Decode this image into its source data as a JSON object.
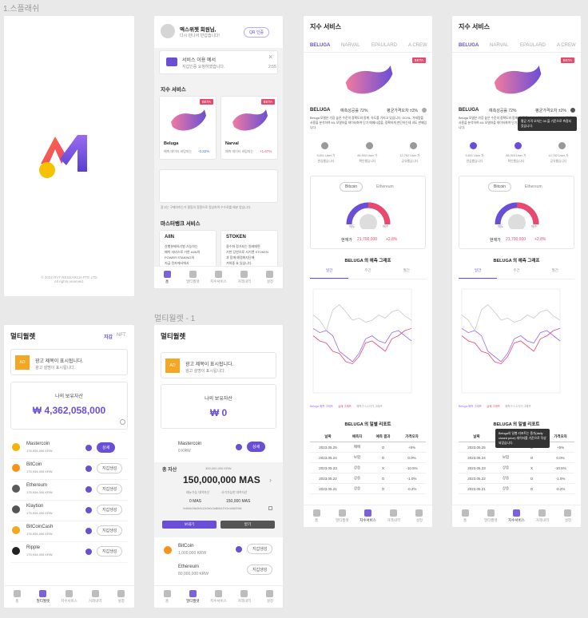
{
  "captions": {
    "splash": "1.스플래쉬",
    "wallet1": "멀티월렛 - 1"
  },
  "splash": {
    "copyright": "© 2022 RVT RESEARCH PTE LTD\nAll rights reserved."
  },
  "home": {
    "greeting": "엑스위젯 회원님,",
    "greeting_sub": "다시 만나서 반갑습니다!",
    "qr_button": "QR 인증",
    "notice_title": "서비스 이용 예서",
    "notice_body": "지갑인증 요청하였습니다.",
    "notice_time": "2:55",
    "index_section": "지수 서비스",
    "beta": "BETA",
    "beluga_name": "Beluga",
    "beluga_sub": "예측 데이터 바탕파는",
    "beluga_change": "-0.32%",
    "narval_name": "Narval",
    "narval_sub": "예측 데이터 바탕파는",
    "narval_change": "+1.67%",
    "banner_caption": "광고는 구매하하는가 필링의 정환으로 정상하여 수수료를 배분 받습니다.",
    "mastercard_section": "마스터뱅크 서비스",
    "ain_title": "AIIN",
    "ain_body": "산행분배하기벌 기능하는\n매칙 서비스로 거한 AIIN의\nPOWER STAKING의\n지급 전자에서에서",
    "token_title": "STOKEN",
    "token_body": "용수화 정거되는 원레매면\n기반 당연으로 서기엔 STOKEN\n과 함께 예정화지단에\n겨워중 효 있습니다."
  },
  "tabs": [
    "홈",
    "멀티월렛",
    "지수서비스",
    "거래내역",
    "설정"
  ],
  "wallet_a": {
    "title": "멀티월렛",
    "tab_wallet": "지갑",
    "tab_nft": "NFT",
    "ad_logo": "AD",
    "ad_title": "광고 제목이 표시됩니다.",
    "ad_sub": "광고 설명이 표시됩니다.",
    "asset_label": "나의 보유자산",
    "asset_value": "₩ 4,362,058,000",
    "coins": [
      {
        "name": "Mastercoin",
        "sub": "175,934,000 KRW",
        "action": "상세",
        "color": "#f6b400"
      },
      {
        "name": "BitCoin",
        "sub": "175,934,000 KRW",
        "action": "지갑생성",
        "color": "#f7931a"
      },
      {
        "name": "Ethereum",
        "sub": "175,934,000 KRW",
        "action": "지갑생성",
        "color": "#5a5a5a"
      },
      {
        "name": "Klaytion",
        "sub": "175,934,000 KRW",
        "action": "지갑생성",
        "color": "#555555"
      },
      {
        "name": "BitCoinCash",
        "sub": "175,934,000 KRW",
        "action": "지갑생성",
        "color": "#f5a623"
      },
      {
        "name": "Ripple",
        "sub": "175,934,000 KRW",
        "action": "지갑생성",
        "color": "#222222"
      }
    ]
  },
  "wallet_b": {
    "title": "멀티월렛",
    "ad_logo": "AD",
    "ad_title": "광고 제목이 표시됩니다.",
    "ad_sub": "광고 설명이 표시됩니다.",
    "asset_label": "나의 보유자산",
    "asset_value": "₩ 0",
    "coin_name": "Mastercoin",
    "coin_sub": "0 KRW",
    "coin_action": "상세",
    "total_label": "총 자산",
    "total_krw": "300,000,000 KRW",
    "total_mas": "150,000,000 MAS",
    "col1": "래뉴가능 대여자산",
    "col2": "사기가능한 대여자산",
    "col1_val": "0 MAS",
    "col2_val": "150,000 MAS",
    "address": "0x4b6e1f6a3b9c12e0e0c3a8b5d1f7e2c4a9d0f3b6",
    "send": "보내기",
    "receive": "받기",
    "coin2_name": "BitCoin",
    "coin2_sub": "1,000,000 KRW",
    "coin2_action": "지갑생성",
    "coin3_name": "Ethereum",
    "coin3_sub": "80,000,000 KRW",
    "coin3_action": "지갑생성"
  },
  "index": {
    "title": "지수 서비스",
    "tabs": [
      "BELUGA",
      "NARVAL",
      "EPAULARD",
      "A CREW"
    ],
    "beta": "BETA",
    "name": "BELUGA",
    "success_rate": "예측성공률 72%",
    "avg_error": "평균가격오차 ±2%",
    "description": "Beluga 모델은 가장 높은 수준의 정확도와 함께, 속도를 가지고 있습니다. OCHL, 거래량을 사용을 분석하여 ML 모델하을 데이터화여 단기 매매시점을, 정확하게 판단하는데 과도 판매입니다.",
    "stats": [
      {
        "value": "9,801 User 가",
        "label": "관심했습니다"
      },
      {
        "value": "86,903 User 가",
        "label": "확인했습니다"
      },
      {
        "value": "12,762 User 가",
        "label": "공유했습니다"
      }
    ],
    "coin_tabs": [
      "Bitcoin",
      "Ethereum"
    ],
    "gauge_left": "매도",
    "gauge_right": "매수",
    "current_label": "현재가",
    "current_price": "21,700,000",
    "current_change": "+2.8%",
    "chart_title": "BELUGA 의 예측 그래프",
    "period_tabs": [
      "일간",
      "주간",
      "월간"
    ],
    "legend": [
      "Beluga 예측 그래프",
      "실제 그래프",
      "예측가 0.1거가 그래프"
    ],
    "report_title": "BELUGA 의 일별 리포트",
    "report_cols": [
      "날짜",
      "예측자",
      "예측 결과",
      "가격오차"
    ],
    "report_rows": [
      [
        "2023.05.25",
        "매매",
        "O",
        "+5%"
      ],
      [
        "2023.05.24",
        "보합",
        "O",
        "0.0%"
      ],
      [
        "2023.05.23",
        "상승",
        "X",
        "-10.5%"
      ],
      [
        "2023.05.22",
        "상승",
        "O",
        "-1.0%"
      ],
      [
        "2023.05.21",
        "상승",
        "O",
        "-0.2%"
      ]
    ],
    "tooltip_error": "평균 가격 오차는 00 을 기준으로 측정되었습니다.",
    "tooltip_report": "Beluga의 일별 리포트는 종가(daily closed price) 데이터를 기준으로 작성되었습니다."
  },
  "chart_data": {
    "type": "line",
    "title": "BELUGA 의 예측 그래프",
    "series": [
      {
        "name": "Beluga 예측 그래프",
        "values": [
          62,
          58,
          60,
          55,
          40,
          35,
          30,
          38,
          52,
          55,
          50,
          48,
          58,
          60,
          55,
          50
        ]
      },
      {
        "name": "실제 그래프",
        "values": [
          55,
          50,
          48,
          40,
          38,
          30,
          28,
          35,
          48,
          50,
          45,
          40,
          52,
          55,
          60,
          62
        ]
      },
      {
        "name": "예측가 0.1거가 그래프",
        "values": [
          75,
          70,
          60,
          80,
          85,
          78,
          70,
          72,
          68,
          70,
          75,
          72,
          78,
          80,
          74,
          70
        ]
      }
    ]
  },
  "colors": {
    "accent": "#6a4fd6",
    "pink": "#e8496d",
    "orange": "#f5a623"
  }
}
